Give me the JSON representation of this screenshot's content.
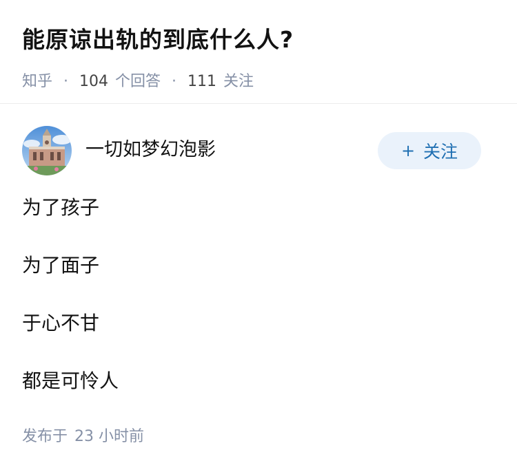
{
  "question": {
    "title": "能原谅出轨的到底什么人?",
    "source": "知乎",
    "separator": "·",
    "answer_count": "104",
    "answer_label": "个回答",
    "follower_count": "111",
    "follower_label": "关注"
  },
  "author": {
    "name": "一切如梦幻泡影",
    "avatar_icon": "church-photo-avatar",
    "follow_icon": "plus-icon",
    "follow_plus": "+",
    "follow_label": "关注",
    "follow_color": "#1f6fb2",
    "follow_bg": "#eaf2fb"
  },
  "answer": {
    "lines": [
      "为了孩子",
      "为了面子",
      "于心不甘",
      "都是可怜人"
    ]
  },
  "footer": {
    "publish_prefix": "发布于",
    "publish_time": "23 小时前"
  },
  "colors": {
    "meta_gray": "#8590a6",
    "text": "#121212"
  }
}
